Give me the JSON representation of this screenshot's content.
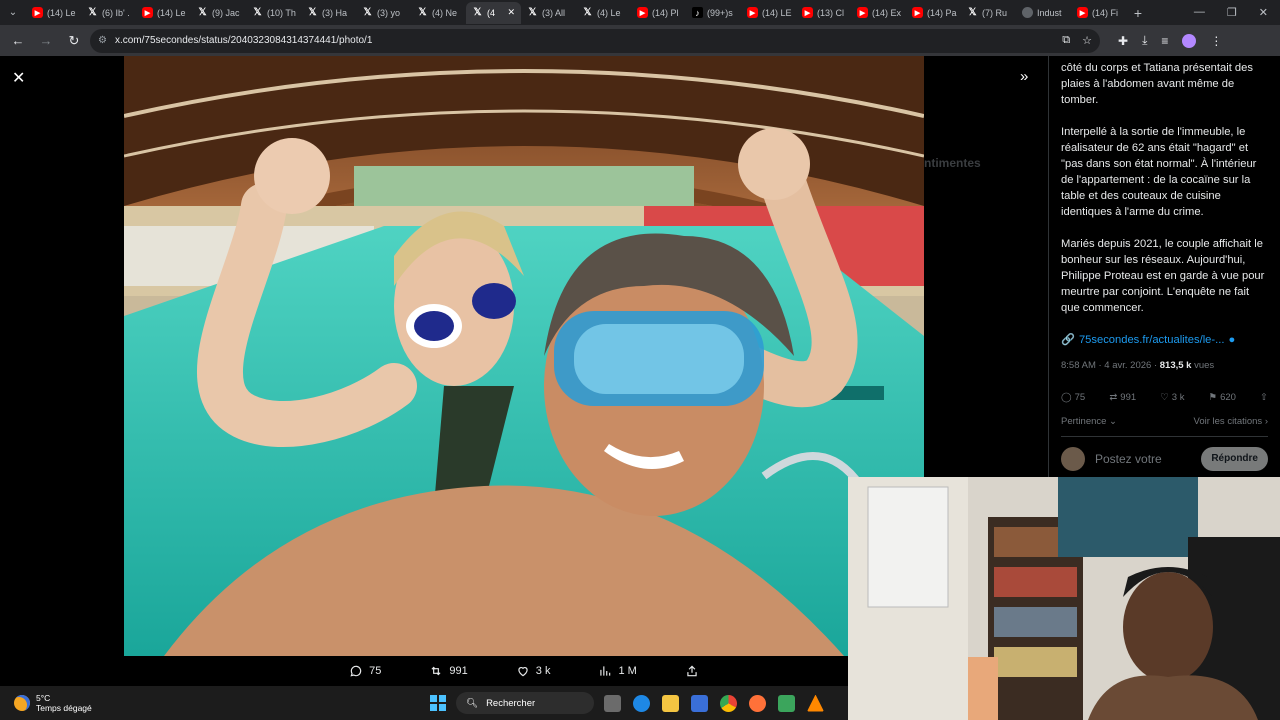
{
  "browser": {
    "tabs": [
      {
        "type": "yt",
        "label": "(14) Le"
      },
      {
        "type": "x",
        "label": "(6) Ib' ."
      },
      {
        "type": "yt",
        "label": "(14) Le"
      },
      {
        "type": "x",
        "label": "(9) Jac"
      },
      {
        "type": "x",
        "label": "(10) Th"
      },
      {
        "type": "x",
        "label": "(3) Ha"
      },
      {
        "type": "x",
        "label": "(3) yo"
      },
      {
        "type": "x",
        "label": "(4) Ne"
      },
      {
        "type": "x",
        "label": "(4"
      },
      {
        "type": "x",
        "label": "(3) All"
      },
      {
        "type": "x",
        "label": "(4) Le"
      },
      {
        "type": "yt",
        "label": "(14) Pl"
      },
      {
        "type": "tt",
        "label": "(99+)s"
      },
      {
        "type": "yt",
        "label": "(14) LE"
      },
      {
        "type": "yt",
        "label": "(13) Cl"
      },
      {
        "type": "yt",
        "label": "(14) Ex"
      },
      {
        "type": "yt",
        "label": "(14) Pa"
      },
      {
        "type": "x",
        "label": "(7) Ru"
      },
      {
        "type": "gl",
        "label": "Indust"
      },
      {
        "type": "yt",
        "label": "(14) Fi"
      }
    ],
    "active_tab_index": 8,
    "url": "x.com/75secondes/status/2040323084314374441/photo/1"
  },
  "tweet": {
    "paragraphs": [
      "côté du corps et Tatiana présentait des plaies à l'abdomen avant même de tomber.",
      "Interpellé à la sortie de l'immeuble, le réalisateur de 62 ans était \"hagard\" et \"pas dans son état normal\". À l'intérieur de l'appartement : de la cocaïne sur la table et des couteaux de cuisine identiques à l'arme du crime.",
      "Mariés depuis 2021, le couple affichait le bonheur sur les réseaux. Aujourd'hui, Philippe Proteau est en garde à vue pour meurtre par conjoint. L'enquête ne fait que commencer."
    ],
    "link_text": "75secondes.fr/actualites/le-...",
    "time": "8:58 AM · 4 avr. 2026 · ",
    "views_count": "813,5 k",
    "views_label": " vues",
    "stats": {
      "replies": "75",
      "reposts": "991",
      "likes": "3 k",
      "bookmarks": "620"
    },
    "sort_label": "Pertinence",
    "quotes_label": "Voir les citations",
    "reply_placeholder": "Postez votre",
    "reply_button": "Répondre",
    "ghost_heading": "ntimentes"
  },
  "viewer_actions": {
    "replies": "75",
    "reposts": "991",
    "likes": "3 k",
    "views": "1 M"
  },
  "taskbar": {
    "temp": "5°C",
    "weather": "Temps dégagé",
    "search": "Rechercher"
  }
}
